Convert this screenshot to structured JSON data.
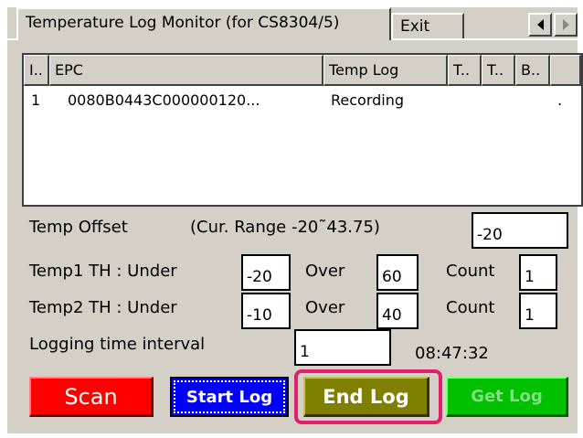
{
  "tabs": [
    {
      "label": "Temperature Log Monitor (for CS8304/5)",
      "active": true
    },
    {
      "label": "Exit",
      "active": false
    }
  ],
  "icons": {
    "scroll_left": "chevron-left-icon",
    "scroll_right": "chevron-right-icon"
  },
  "list": {
    "columns": [
      "I..",
      "EPC",
      "Temp Log",
      "T..",
      "T..",
      "B..",
      ""
    ],
    "rows": [
      {
        "index": "1",
        "epc": "0080B0443C000000120...",
        "temp_log": "Recording",
        "t1": "",
        "t2": "",
        "b": "."
      }
    ]
  },
  "temp_offset": {
    "label": "Temp Offset",
    "range_label": "(Cur. Range -20˜43.75)",
    "value": "-20"
  },
  "temp1": {
    "label": "Temp1 TH : Under",
    "under": "-20",
    "over_label": "Over",
    "over": "60",
    "count_label": "Count",
    "count": "1"
  },
  "temp2": {
    "label": "Temp2 TH : Under",
    "under": "-10",
    "over_label": "Over",
    "over": "40",
    "count_label": "Count",
    "count": "1"
  },
  "logging": {
    "label": "Logging time interval",
    "value": "1",
    "clock": "08:47:32"
  },
  "buttons": {
    "scan": "Scan",
    "start_log": "Start Log",
    "end_log": "End Log",
    "get_log": "Get Log"
  },
  "colors": {
    "scan": "#ff0000",
    "start_log": "#0000ff",
    "end_log": "#808000",
    "get_log": "#00c000",
    "highlight": "#e0206a",
    "window_bg": "#d4d0c8"
  }
}
